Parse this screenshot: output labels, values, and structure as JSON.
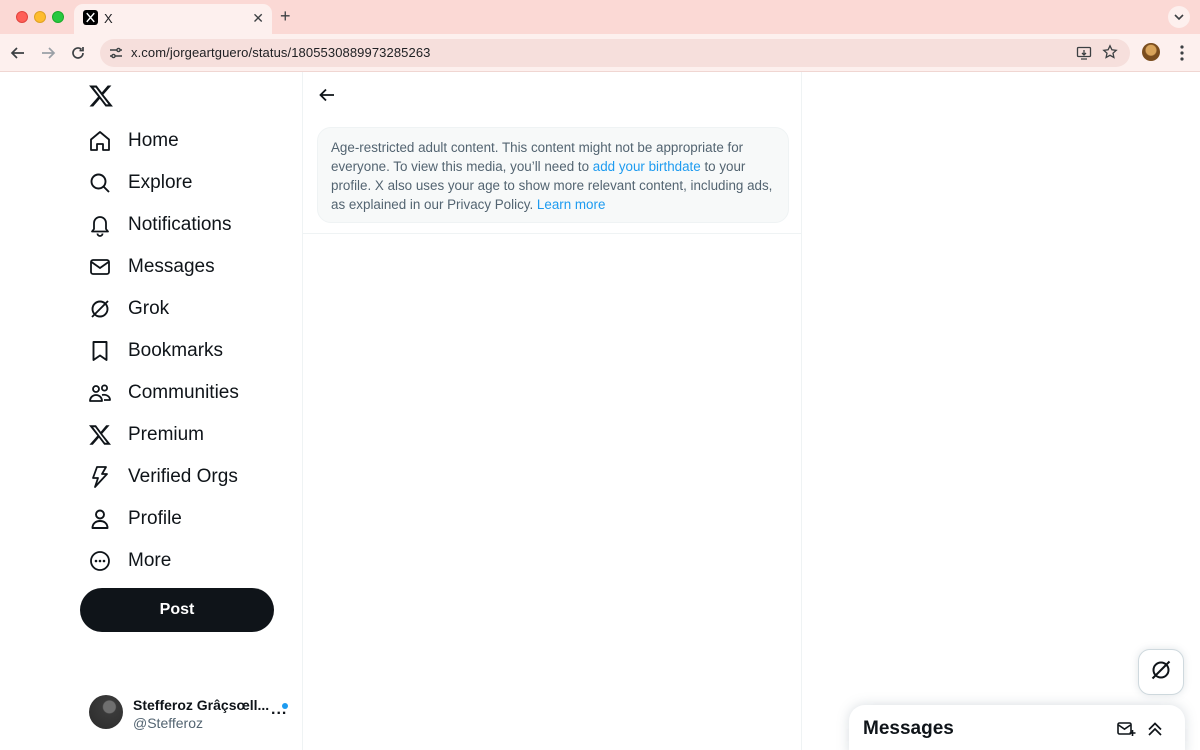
{
  "browser": {
    "tab_title": "X",
    "url": "x.com/jorgeartguero/status/1805530889973285263"
  },
  "nav": {
    "items": [
      {
        "label": "Home",
        "icon": "home-icon"
      },
      {
        "label": "Explore",
        "icon": "search-icon"
      },
      {
        "label": "Notifications",
        "icon": "bell-icon"
      },
      {
        "label": "Messages",
        "icon": "envelope-icon"
      },
      {
        "label": "Grok",
        "icon": "grok-icon"
      },
      {
        "label": "Bookmarks",
        "icon": "bookmark-icon"
      },
      {
        "label": "Communities",
        "icon": "people-icon"
      },
      {
        "label": "Premium",
        "icon": "x-logo-icon"
      },
      {
        "label": "Verified Orgs",
        "icon": "lightning-icon"
      },
      {
        "label": "Profile",
        "icon": "person-icon"
      },
      {
        "label": "More",
        "icon": "more-circle-icon"
      }
    ],
    "post_label": "Post"
  },
  "account": {
    "name": "Stefferoz Grâçsœll...",
    "handle": "@Stefferoz",
    "more": "..."
  },
  "notice": {
    "text_1": "Age-restricted adult content. This content might not be appropriate for everyone. To view this media, you’ll need to ",
    "link_1": "add your birthdate",
    "text_2": " to your profile. X also uses your age to show more relevant content, including ads, as explained in our Privacy Policy. ",
    "link_2": "Learn more"
  },
  "messages_drawer": {
    "title": "Messages"
  },
  "colors": {
    "accent": "#1d9bf0",
    "post_button": "#0f1419",
    "browser_frame": "#fbd9d5"
  }
}
